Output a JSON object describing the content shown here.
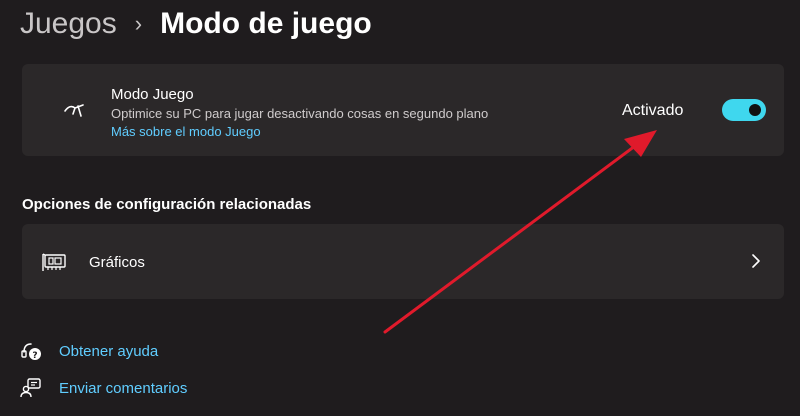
{
  "breadcrumb": {
    "parent": "Juegos",
    "separator": "›",
    "current": "Modo de juego"
  },
  "game_mode": {
    "title": "Modo Juego",
    "description": "Optimice su PC para jugar desactivando cosas en segundo plano",
    "link": "Más sobre el modo Juego",
    "toggle_label": "Activado",
    "toggle_on": true,
    "icon": "game-mode-icon"
  },
  "related": {
    "heading": "Opciones de configuración relacionadas",
    "graphics_label": "Gráficos",
    "graphics_icon": "graphics-card-icon"
  },
  "help": {
    "get_help": "Obtener ayuda",
    "feedback": "Enviar comentarios"
  },
  "colors": {
    "background": "#1f1c1e",
    "card": "#2b2829",
    "accent": "#3fd7ee",
    "link": "#60cdff",
    "annotation_arrow": "#e01a2b"
  }
}
